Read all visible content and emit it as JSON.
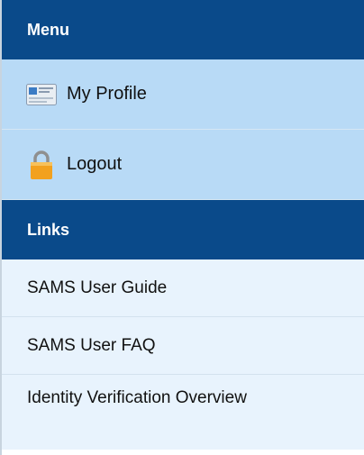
{
  "menu": {
    "header": "Menu",
    "items": [
      {
        "label": "My Profile",
        "icon": "profile-card-icon"
      },
      {
        "label": "Logout",
        "icon": "padlock-icon"
      }
    ]
  },
  "links": {
    "header": "Links",
    "items": [
      {
        "label": "SAMS User Guide"
      },
      {
        "label": "SAMS User FAQ"
      },
      {
        "label": "Identity Verification Overview"
      }
    ]
  },
  "colors": {
    "header_bg": "#0a4a8a",
    "menu_item_bg": "#b8daf6",
    "link_item_bg": "#e8f3fd",
    "padlock": "#f2a11f"
  }
}
